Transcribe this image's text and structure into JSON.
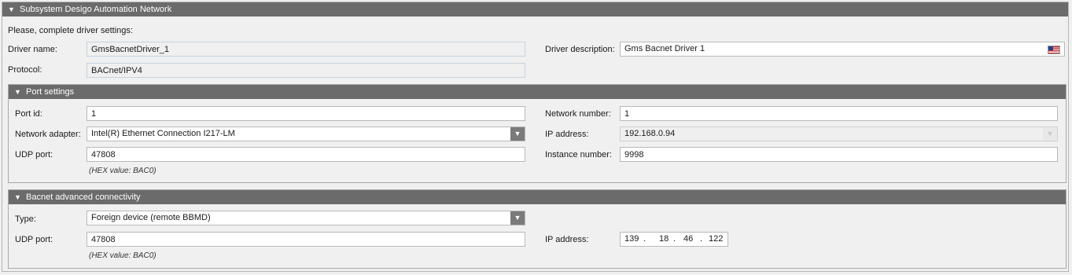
{
  "subsystem": {
    "title": "Subsystem Desigo Automation Network",
    "prompt": "Please, complete driver settings:",
    "driver_name_label": "Driver name:",
    "driver_name_value": "GmsBacnetDriver_1",
    "protocol_label": "Protocol:",
    "protocol_value": "BACnet/IPV4",
    "driver_description_label": "Driver description:",
    "driver_description_value": "Gms Bacnet Driver 1",
    "language_icon": "us-flag-icon"
  },
  "port_settings": {
    "title": "Port settings",
    "port_id_label": "Port id:",
    "port_id_value": "1",
    "network_adapter_label": "Network adapter:",
    "network_adapter_value": "Intel(R) Ethernet Connection I217-LM",
    "udp_port_label": "UDP port:",
    "udp_port_value": "47808",
    "udp_hex_hint": "(HEX value: BAC0)",
    "network_number_label": "Network number:",
    "network_number_value": "1",
    "ip_address_label": "IP address:",
    "ip_address_value": "192.168.0.94",
    "instance_number_label": "Instance number:",
    "instance_number_value": "9998"
  },
  "advanced": {
    "title": "Bacnet advanced connectivity",
    "type_label": "Type:",
    "type_value": "Foreign device (remote BBMD)",
    "udp_port_label": "UDP port:",
    "udp_port_value": "47808",
    "udp_hex_hint": "(HEX value: BAC0)",
    "ip_address_label": "IP address:",
    "ip_octets": [
      "139",
      "18",
      "46",
      "122"
    ],
    "ip_dot": "."
  },
  "colors": {
    "header_bg": "#6b6b6b",
    "panel_bg": "#f0f0f0",
    "dropdown_button": "#7a7a7a"
  }
}
